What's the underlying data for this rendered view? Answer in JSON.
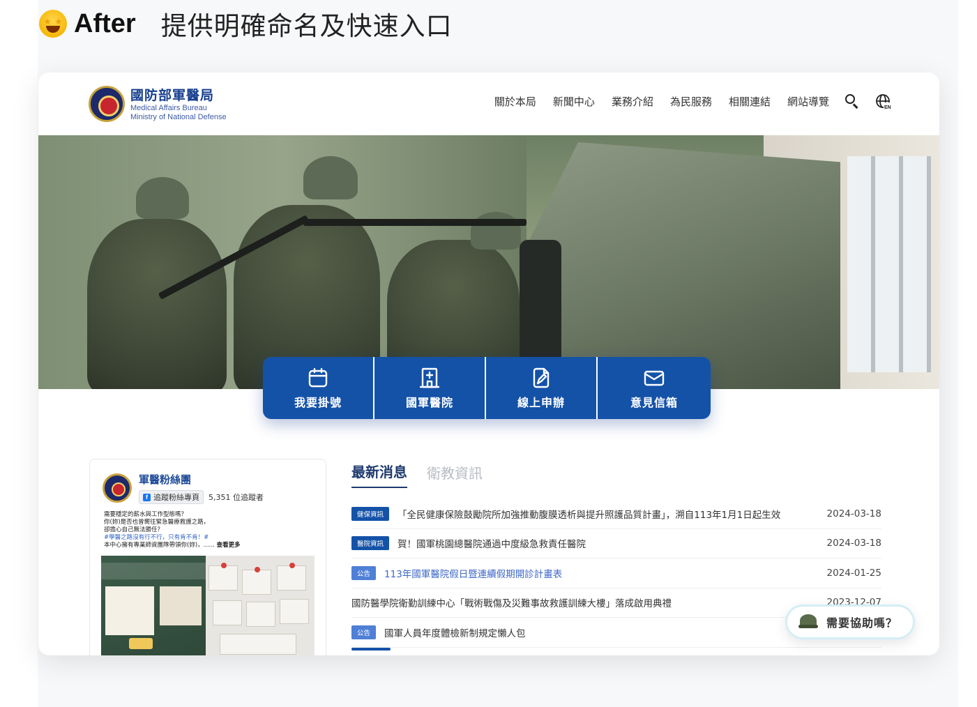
{
  "heading": {
    "after_label": "After",
    "subtitle": "提供明確命名及快速入口"
  },
  "site": {
    "org_name_zh": "國防部軍醫局",
    "org_name_en_1": "Medical Affairs Bureau",
    "org_name_en_2": "Ministry of National Defense",
    "nav": [
      "關於本局",
      "新聞中心",
      "業務介紹",
      "為民服務",
      "相關連結",
      "網站導覽"
    ],
    "icons": {
      "search": "search-icon",
      "language": "globe-en-icon"
    }
  },
  "quick_links": [
    {
      "label": "我要掛號",
      "icon": "calendar-icon"
    },
    {
      "label": "國軍醫院",
      "icon": "hospital-icon"
    },
    {
      "label": "線上申辦",
      "icon": "document-edit-icon"
    },
    {
      "label": "意見信箱",
      "icon": "mail-icon"
    }
  ],
  "fb_widget": {
    "page_name": "軍醫粉絲團",
    "follow_button": "追蹤粉絲專頁",
    "followers": "5,351 位追蹤者",
    "post_lines": [
      "需要穩定的薪水與工作型態嗎？",
      "你(妳)是否也曾嚮往緊急醫療救護之路，",
      "卻擔心自己無法勝任？",
      "#學醫之路沒有行不行，只有肯不肯！#",
      "本中心擁有專業師資團隊帶領你(妳)，......"
    ],
    "more_label": "查看更多"
  },
  "news": {
    "tabs": [
      "最新消息",
      "衛教資訊"
    ],
    "active_tab": 0,
    "items": [
      {
        "tag": "健保資訊",
        "tag_color": "#1452a8",
        "title": "「全民健康保險鼓勵院所加強推動腹膜透析與提升照護品質計畫」，溯自113年1月1日起生效",
        "date": "2024-03-18",
        "link": false
      },
      {
        "tag": "醫院資訊",
        "tag_color": "#1452a8",
        "title": "賀！國軍桃園總醫院通過中度級急救責任醫院",
        "date": "2024-03-18",
        "link": false
      },
      {
        "tag": "公告",
        "tag_color": "#4f7fd6",
        "title": "113年國軍醫院假日暨連續假期開診計畫表",
        "date": "2024-01-25",
        "link": true
      },
      {
        "tag": "",
        "tag_color": "",
        "title": "國防醫學院衛勤訓練中心「戰術戰傷及災難事故救護訓練大樓」落成啟用典禮",
        "date": "2023-12-07",
        "link": false
      },
      {
        "tag": "公告",
        "tag_color": "#4f7fd6",
        "title": "國軍人員年度體檢新制規定懶人包",
        "date": "",
        "link": false
      }
    ]
  },
  "help_button": {
    "label": "需要協助嗎？",
    "icon": "helmet-icon"
  }
}
